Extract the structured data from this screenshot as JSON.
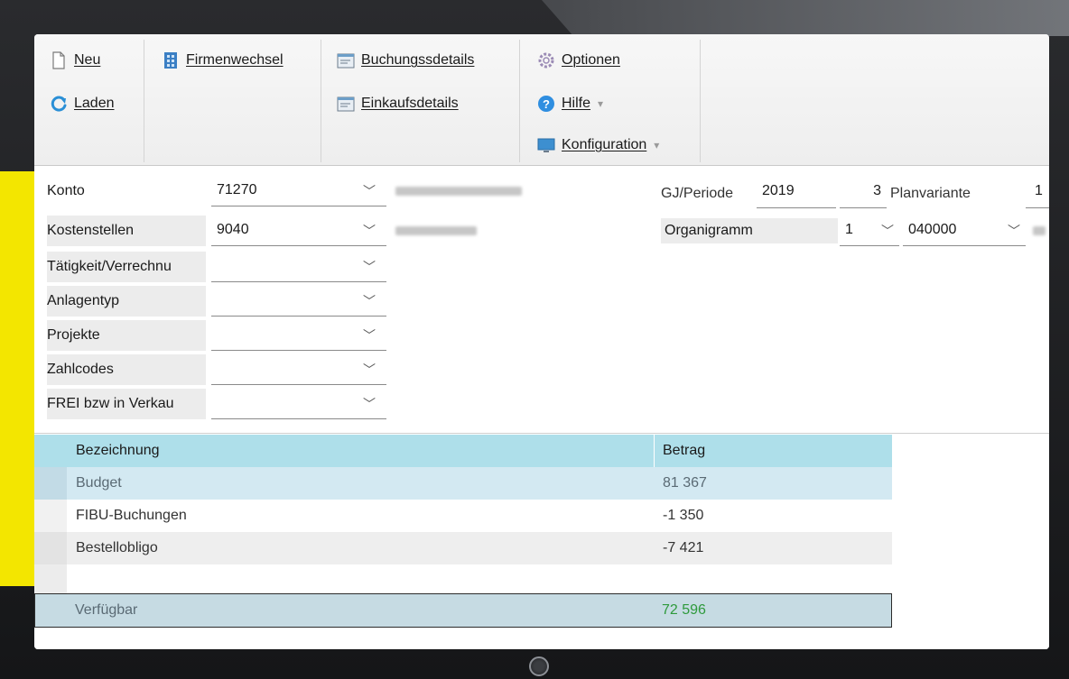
{
  "ribbon": {
    "new_label": "Neu",
    "load_label": "Laden",
    "company_switch_label": "Firmenwechsel",
    "booking_details_label": "Buchungssdetails",
    "purchase_details_label": "Einkaufsdetails",
    "options_label": "Optionen",
    "help_label": "Hilfe",
    "configuration_label": "Konfiguration"
  },
  "form": {
    "left_fields": [
      {
        "label": "Konto",
        "value": "71270"
      },
      {
        "label": "Kostenstellen",
        "value": "9040"
      },
      {
        "label": "Tätigkeit/Verrechnu",
        "value": ""
      },
      {
        "label": "Anlagentyp",
        "value": ""
      },
      {
        "label": "Projekte",
        "value": ""
      },
      {
        "label": "Zahlcodes",
        "value": ""
      },
      {
        "label": "FREI bzw in Verkau",
        "value": ""
      }
    ],
    "gj_periode_label": "GJ/Periode",
    "gj_value": "2019",
    "periode_value": "3",
    "planvariante_label": "Planvariante",
    "planvariante_value": "1",
    "organigramm_label": "Organigramm",
    "organigramm_value": "1",
    "organigramm_code": "040000"
  },
  "grid": {
    "columns": [
      "Bezeichnung",
      "Betrag"
    ],
    "rows": [
      {
        "label": "Budget",
        "value": "81 367"
      },
      {
        "label": "FIBU-Buchungen",
        "value": "-1 350"
      },
      {
        "label": "Bestellobligo",
        "value": "-7 421"
      }
    ],
    "total": {
      "label": "Verfügbar",
      "value": "72 596"
    }
  },
  "colors": {
    "header_bg": "#aedfea",
    "selected_row_bg": "#d3e9f2",
    "total_value": "#2e9a3c",
    "accent_yellow": "#f3e600"
  }
}
